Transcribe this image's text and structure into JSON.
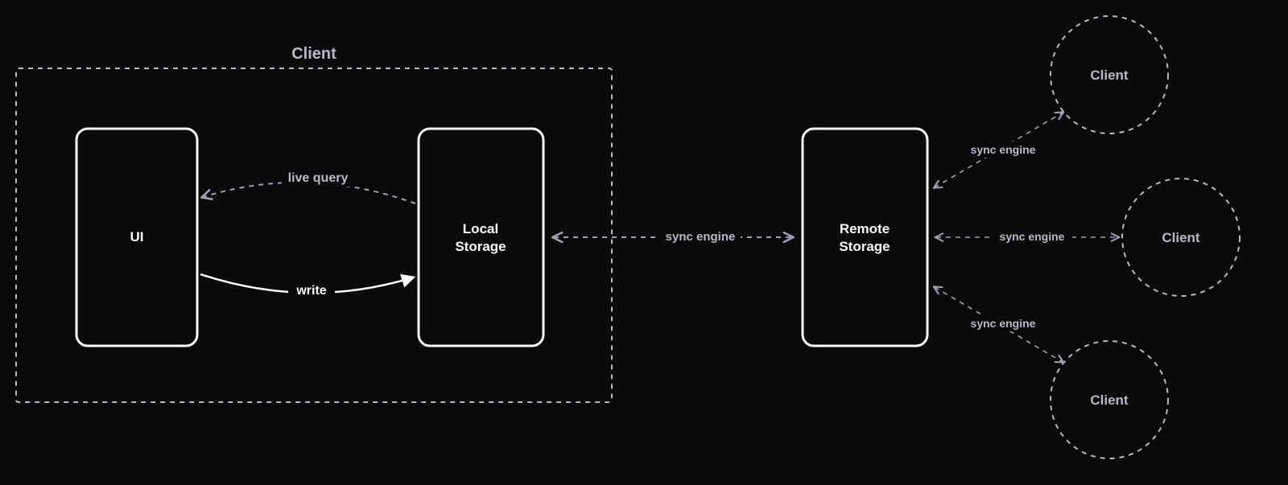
{
  "container": {
    "title": "Client"
  },
  "nodes": {
    "ui": {
      "label": "UI"
    },
    "local_storage": {
      "label_line1": "Local",
      "label_line2": "Storage"
    },
    "remote_storage": {
      "label_line1": "Remote",
      "label_line2": "Storage"
    },
    "client_a": {
      "label": "Client"
    },
    "client_b": {
      "label": "Client"
    },
    "client_c": {
      "label": "Client"
    }
  },
  "edges": {
    "live_query": {
      "label": "live query"
    },
    "write": {
      "label": "write"
    },
    "local_remote": {
      "label": "sync engine"
    },
    "remote_client_a": {
      "label": "sync engine"
    },
    "remote_client_b": {
      "label": "sync engine"
    },
    "remote_client_c": {
      "label": "sync engine"
    }
  }
}
